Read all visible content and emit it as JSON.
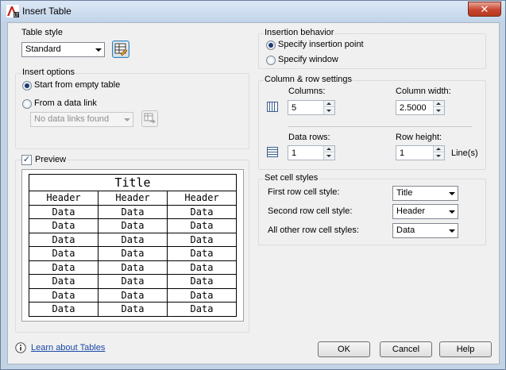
{
  "window": {
    "title": "Insert Table",
    "close_label": "✕"
  },
  "table_style": {
    "group_label": "Table style",
    "selected": "Standard"
  },
  "insert_options": {
    "group_label": "Insert options",
    "empty_label": "Start from empty table",
    "data_link_label": "From a data link",
    "data_link_combo": "No data links found"
  },
  "preview": {
    "checkbox_label": "Preview",
    "checked": true,
    "title": "Title",
    "headers": [
      "Header",
      "Header",
      "Header"
    ],
    "rows": [
      [
        "Data",
        "Data",
        "Data"
      ],
      [
        "Data",
        "Data",
        "Data"
      ],
      [
        "Data",
        "Data",
        "Data"
      ],
      [
        "Data",
        "Data",
        "Data"
      ],
      [
        "Data",
        "Data",
        "Data"
      ],
      [
        "Data",
        "Data",
        "Data"
      ],
      [
        "Data",
        "Data",
        "Data"
      ],
      [
        "Data",
        "Data",
        "Data"
      ]
    ]
  },
  "insertion_behavior": {
    "group_label": "Insertion behavior",
    "point_label": "Specify insertion point",
    "window_label": "Specify window"
  },
  "col_row": {
    "group_label": "Column & row settings",
    "columns_label": "Columns:",
    "columns_value": "5",
    "col_width_label": "Column width:",
    "col_width_value": "2.5000",
    "data_rows_label": "Data rows:",
    "data_rows_value": "1",
    "row_height_label": "Row height:",
    "row_height_value": "1",
    "lines_label": "Line(s)"
  },
  "cell_styles": {
    "group_label": "Set cell styles",
    "first_label": "First row cell style:",
    "first_value": "Title",
    "second_label": "Second row cell style:",
    "second_value": "Header",
    "other_label": "All other row cell styles:",
    "other_value": "Data"
  },
  "footer": {
    "help_link": "Learn about Tables",
    "ok": "OK",
    "cancel": "Cancel",
    "help": "Help"
  },
  "colors": {
    "link": "#1a49a8",
    "frame": "#c3d3e6"
  }
}
